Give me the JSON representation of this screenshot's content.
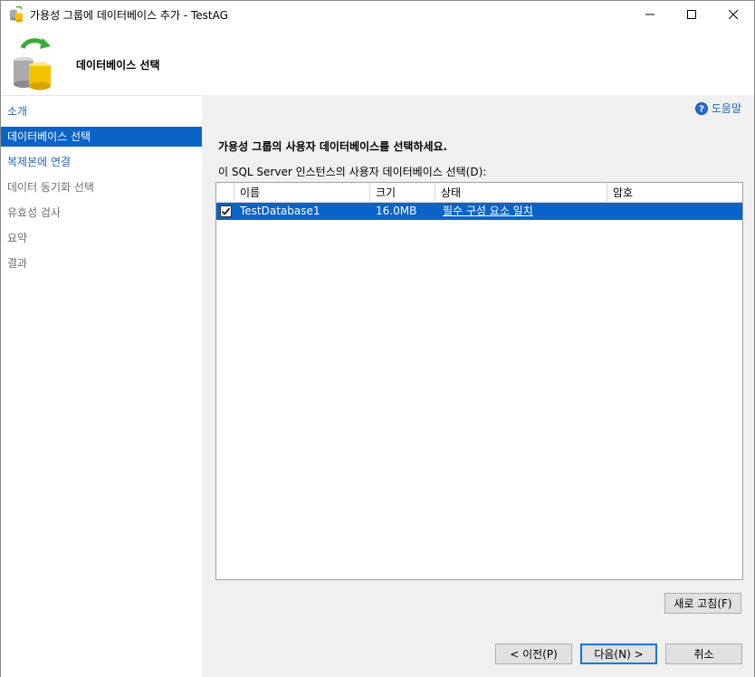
{
  "window": {
    "title": "가용성 그룹에 데이터베이스 추가 - TestAG",
    "app_icon": "database-wizard-icon",
    "controls": {
      "minimize": "minimize-icon",
      "maximize": "maximize-icon",
      "close": "close-icon"
    }
  },
  "header": {
    "title": "데이터베이스 선택",
    "icon": "database-refresh-icon"
  },
  "nav": {
    "items": [
      {
        "label": "소개",
        "state": "link"
      },
      {
        "label": "데이터베이스 선택",
        "state": "selected"
      },
      {
        "label": "복제본에 연결",
        "state": "link"
      },
      {
        "label": "데이터 동기화 선택",
        "state": "disabled"
      },
      {
        "label": "유효성 검사",
        "state": "disabled"
      },
      {
        "label": "요약",
        "state": "disabled"
      },
      {
        "label": "결과",
        "state": "disabled"
      }
    ]
  },
  "main": {
    "help_label": "도움말",
    "instruction": "가용성 그룹의 사용자 데이터베이스를 선택하세요.",
    "grid_label": "이 SQL Server 인스턴스의 사용자 데이터베이스 선택(D):",
    "columns": [
      "이름",
      "크기",
      "상태",
      "암호"
    ],
    "rows": [
      {
        "checked": true,
        "name": "TestDatabase1",
        "size": "16.0MB",
        "status": "필수 구성 요소 일치",
        "password": ""
      }
    ],
    "refresh_button": "새로 고침(F)"
  },
  "footer": {
    "prev_button": "< 이전(P)",
    "next_button": "다음(N) >",
    "cancel_button": "취소"
  },
  "colors": {
    "selection": "#0a64c8",
    "link": "#2465b4",
    "panel_bg": "#f0f0f0"
  }
}
